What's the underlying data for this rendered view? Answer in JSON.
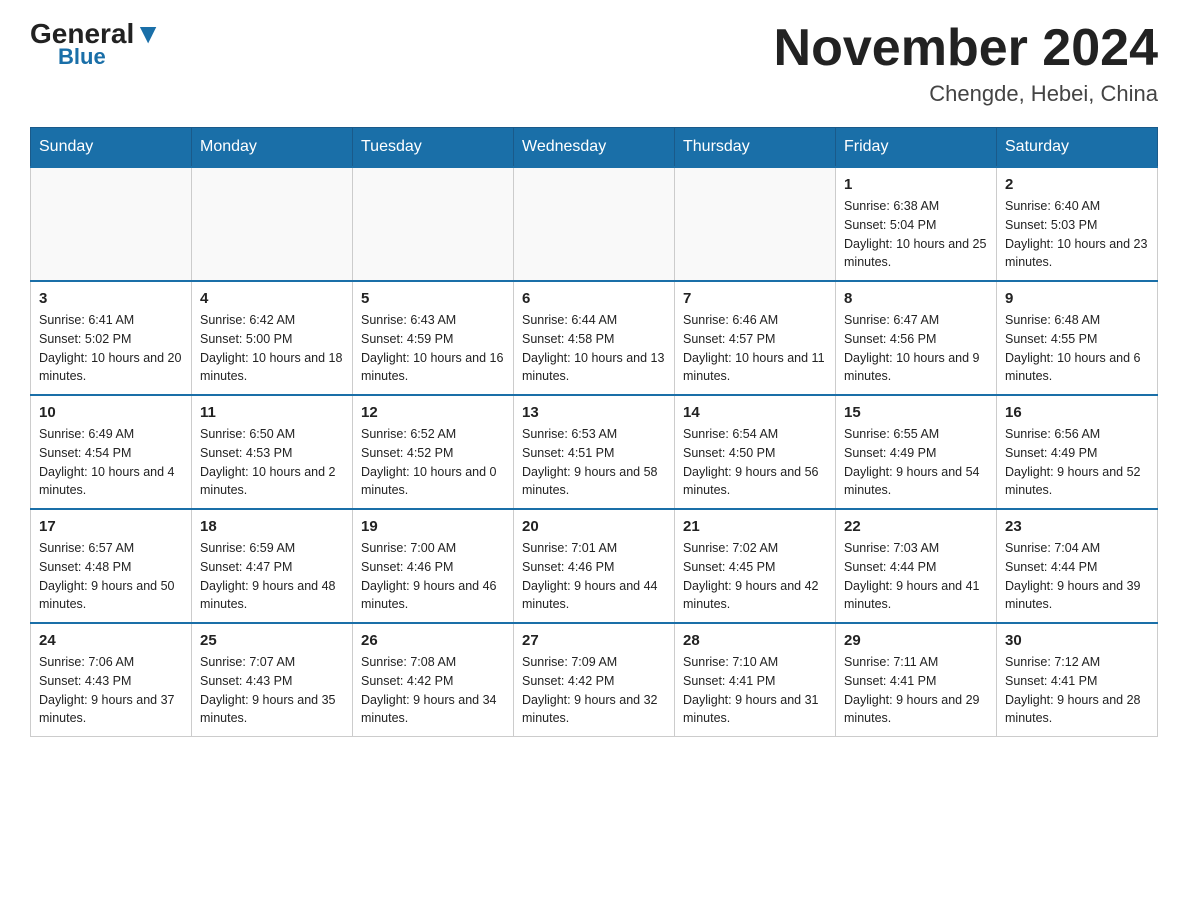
{
  "header": {
    "logo_general": "General",
    "logo_blue": "Blue",
    "month_year": "November 2024",
    "location": "Chengde, Hebei, China"
  },
  "weekdays": [
    "Sunday",
    "Monday",
    "Tuesday",
    "Wednesday",
    "Thursday",
    "Friday",
    "Saturday"
  ],
  "weeks": [
    [
      {
        "day": "",
        "info": ""
      },
      {
        "day": "",
        "info": ""
      },
      {
        "day": "",
        "info": ""
      },
      {
        "day": "",
        "info": ""
      },
      {
        "day": "",
        "info": ""
      },
      {
        "day": "1",
        "info": "Sunrise: 6:38 AM\nSunset: 5:04 PM\nDaylight: 10 hours and 25 minutes."
      },
      {
        "day": "2",
        "info": "Sunrise: 6:40 AM\nSunset: 5:03 PM\nDaylight: 10 hours and 23 minutes."
      }
    ],
    [
      {
        "day": "3",
        "info": "Sunrise: 6:41 AM\nSunset: 5:02 PM\nDaylight: 10 hours and 20 minutes."
      },
      {
        "day": "4",
        "info": "Sunrise: 6:42 AM\nSunset: 5:00 PM\nDaylight: 10 hours and 18 minutes."
      },
      {
        "day": "5",
        "info": "Sunrise: 6:43 AM\nSunset: 4:59 PM\nDaylight: 10 hours and 16 minutes."
      },
      {
        "day": "6",
        "info": "Sunrise: 6:44 AM\nSunset: 4:58 PM\nDaylight: 10 hours and 13 minutes."
      },
      {
        "day": "7",
        "info": "Sunrise: 6:46 AM\nSunset: 4:57 PM\nDaylight: 10 hours and 11 minutes."
      },
      {
        "day": "8",
        "info": "Sunrise: 6:47 AM\nSunset: 4:56 PM\nDaylight: 10 hours and 9 minutes."
      },
      {
        "day": "9",
        "info": "Sunrise: 6:48 AM\nSunset: 4:55 PM\nDaylight: 10 hours and 6 minutes."
      }
    ],
    [
      {
        "day": "10",
        "info": "Sunrise: 6:49 AM\nSunset: 4:54 PM\nDaylight: 10 hours and 4 minutes."
      },
      {
        "day": "11",
        "info": "Sunrise: 6:50 AM\nSunset: 4:53 PM\nDaylight: 10 hours and 2 minutes."
      },
      {
        "day": "12",
        "info": "Sunrise: 6:52 AM\nSunset: 4:52 PM\nDaylight: 10 hours and 0 minutes."
      },
      {
        "day": "13",
        "info": "Sunrise: 6:53 AM\nSunset: 4:51 PM\nDaylight: 9 hours and 58 minutes."
      },
      {
        "day": "14",
        "info": "Sunrise: 6:54 AM\nSunset: 4:50 PM\nDaylight: 9 hours and 56 minutes."
      },
      {
        "day": "15",
        "info": "Sunrise: 6:55 AM\nSunset: 4:49 PM\nDaylight: 9 hours and 54 minutes."
      },
      {
        "day": "16",
        "info": "Sunrise: 6:56 AM\nSunset: 4:49 PM\nDaylight: 9 hours and 52 minutes."
      }
    ],
    [
      {
        "day": "17",
        "info": "Sunrise: 6:57 AM\nSunset: 4:48 PM\nDaylight: 9 hours and 50 minutes."
      },
      {
        "day": "18",
        "info": "Sunrise: 6:59 AM\nSunset: 4:47 PM\nDaylight: 9 hours and 48 minutes."
      },
      {
        "day": "19",
        "info": "Sunrise: 7:00 AM\nSunset: 4:46 PM\nDaylight: 9 hours and 46 minutes."
      },
      {
        "day": "20",
        "info": "Sunrise: 7:01 AM\nSunset: 4:46 PM\nDaylight: 9 hours and 44 minutes."
      },
      {
        "day": "21",
        "info": "Sunrise: 7:02 AM\nSunset: 4:45 PM\nDaylight: 9 hours and 42 minutes."
      },
      {
        "day": "22",
        "info": "Sunrise: 7:03 AM\nSunset: 4:44 PM\nDaylight: 9 hours and 41 minutes."
      },
      {
        "day": "23",
        "info": "Sunrise: 7:04 AM\nSunset: 4:44 PM\nDaylight: 9 hours and 39 minutes."
      }
    ],
    [
      {
        "day": "24",
        "info": "Sunrise: 7:06 AM\nSunset: 4:43 PM\nDaylight: 9 hours and 37 minutes."
      },
      {
        "day": "25",
        "info": "Sunrise: 7:07 AM\nSunset: 4:43 PM\nDaylight: 9 hours and 35 minutes."
      },
      {
        "day": "26",
        "info": "Sunrise: 7:08 AM\nSunset: 4:42 PM\nDaylight: 9 hours and 34 minutes."
      },
      {
        "day": "27",
        "info": "Sunrise: 7:09 AM\nSunset: 4:42 PM\nDaylight: 9 hours and 32 minutes."
      },
      {
        "day": "28",
        "info": "Sunrise: 7:10 AM\nSunset: 4:41 PM\nDaylight: 9 hours and 31 minutes."
      },
      {
        "day": "29",
        "info": "Sunrise: 7:11 AM\nSunset: 4:41 PM\nDaylight: 9 hours and 29 minutes."
      },
      {
        "day": "30",
        "info": "Sunrise: 7:12 AM\nSunset: 4:41 PM\nDaylight: 9 hours and 28 minutes."
      }
    ]
  ]
}
